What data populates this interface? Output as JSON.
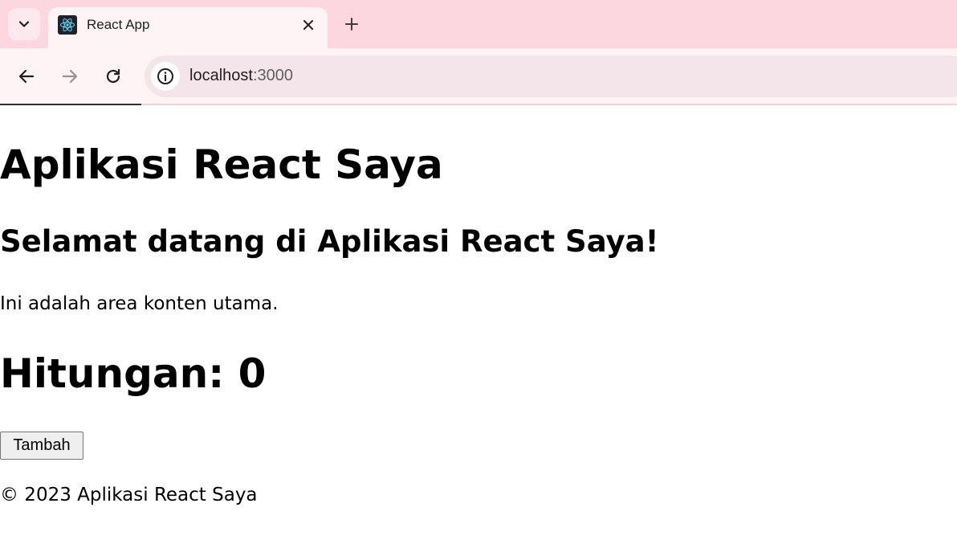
{
  "browser": {
    "tab": {
      "title": "React App",
      "favicon": "react-logo-icon"
    },
    "address_bar": {
      "host": "localhost",
      "port": ":3000"
    },
    "icons": {
      "tab_search": "chevron-down-icon",
      "tab_close": "close-icon",
      "new_tab": "plus-icon",
      "back": "arrow-left-icon",
      "forward": "arrow-right-icon",
      "reload": "reload-icon",
      "site_info": "info-icon"
    },
    "colors": {
      "tabstrip": "#fdd7df",
      "toolbar": "#fff4f5",
      "omnibox": "#f3e5e9"
    }
  },
  "page": {
    "title": "Aplikasi React Saya",
    "welcome_heading": "Selamat datang di Aplikasi React Saya!",
    "paragraph": "Ini adalah area konten utama.",
    "counter": {
      "label": "Hitungan: 0",
      "value": 0
    },
    "add_button_label": "Tambah",
    "footer": "© 2023 Aplikasi React Saya"
  }
}
